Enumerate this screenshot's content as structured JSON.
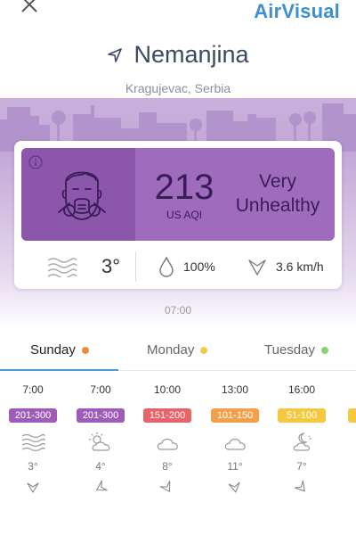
{
  "app": {
    "brand": "AirVisual"
  },
  "location": {
    "name": "Nemanjina",
    "sub": "Kragujevac, Serbia"
  },
  "aqi": {
    "value": "213",
    "unit": "US AQI",
    "status_line1": "Very",
    "status_line2": "Unhealthy",
    "color": "#9f6bbd"
  },
  "weather": {
    "temp": "3°",
    "humidity": "100%",
    "wind": "3.6 km/h"
  },
  "updated_time": "07:00",
  "tabs": [
    {
      "label": "Sunday",
      "dot": "#f0883a"
    },
    {
      "label": "Monday",
      "dot": "#f3c94a"
    },
    {
      "label": "Tuesday",
      "dot": "#8cd16a"
    }
  ],
  "hourly": [
    {
      "time": "7:00",
      "aqi": "201-300",
      "color": "#9e5cb8",
      "icon": "haze-icon",
      "temp": "3°"
    },
    {
      "time": "7:00",
      "aqi": "201-300",
      "color": "#9e5cb8",
      "icon": "partly-sunny-icon",
      "temp": "4°"
    },
    {
      "time": "10:00",
      "aqi": "151-200",
      "color": "#e9646a",
      "icon": "cloud-icon",
      "temp": "8°"
    },
    {
      "time": "13:00",
      "aqi": "101-150",
      "color": "#f4a04a",
      "icon": "cloud-icon",
      "temp": "11°"
    },
    {
      "time": "16:00",
      "aqi": "51-100",
      "color": "#f5c93f",
      "icon": "night-cloud-icon",
      "temp": "7°"
    }
  ]
}
